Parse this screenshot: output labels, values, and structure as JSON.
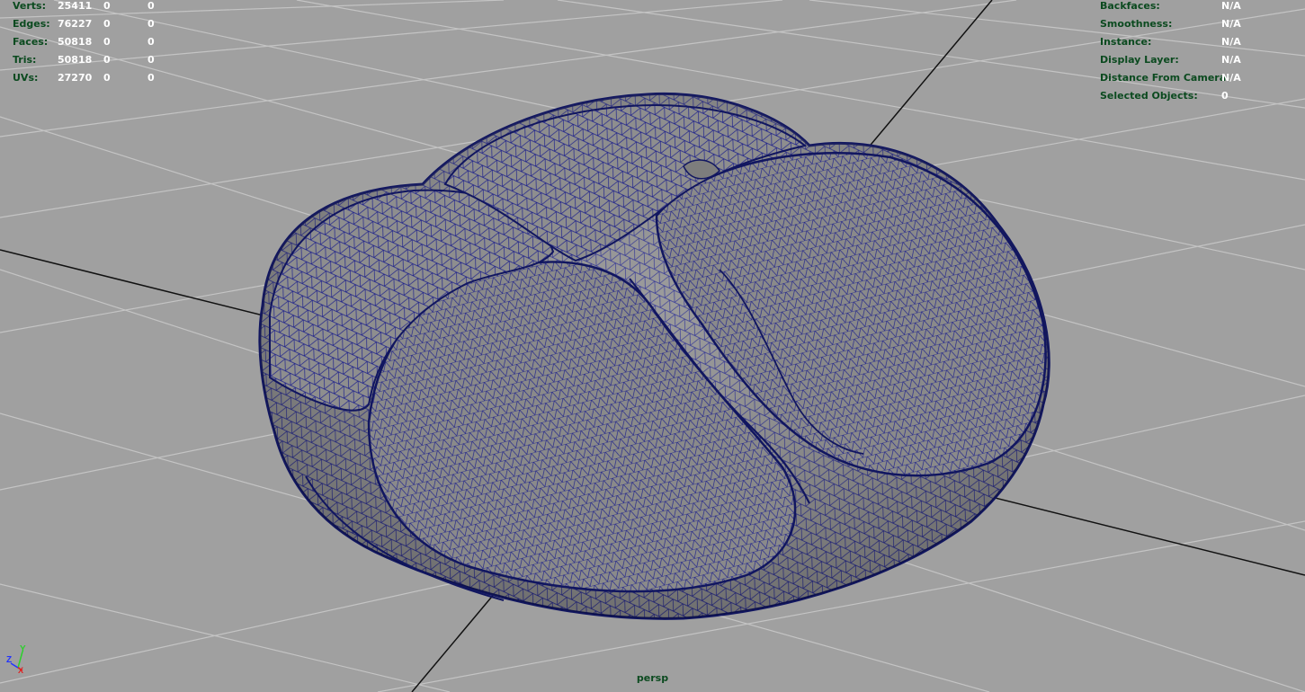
{
  "viewport": {
    "camera": "persp",
    "background_color": "#a0a0a0",
    "wireframe_color": "#1c1f8c",
    "grid_color": "#c2c2c2",
    "axis_line_color": "#000000"
  },
  "stats_left": [
    {
      "label": "Verts:",
      "v1": "25411",
      "v2": "0",
      "v3": "0"
    },
    {
      "label": "Edges:",
      "v1": "76227",
      "v2": "0",
      "v3": "0"
    },
    {
      "label": "Faces:",
      "v1": "50818",
      "v2": "0",
      "v3": "0"
    },
    {
      "label": "Tris:",
      "v1": "50818",
      "v2": "0",
      "v3": "0"
    },
    {
      "label": "UVs:",
      "v1": "27270",
      "v2": "0",
      "v3": "0"
    }
  ],
  "stats_right": [
    {
      "label": "Backfaces:",
      "value": "N/A"
    },
    {
      "label": "Smoothness:",
      "value": "N/A"
    },
    {
      "label": "Instance:",
      "value": "N/A"
    },
    {
      "label": "Display Layer:",
      "value": "N/A"
    },
    {
      "label": "Distance From Camera:",
      "value": "N/A"
    },
    {
      "label": "Selected Objects:",
      "value": "0"
    }
  ],
  "axis_gizmo": {
    "y_label": "Y",
    "z_label": "Z",
    "x_label": "X"
  }
}
